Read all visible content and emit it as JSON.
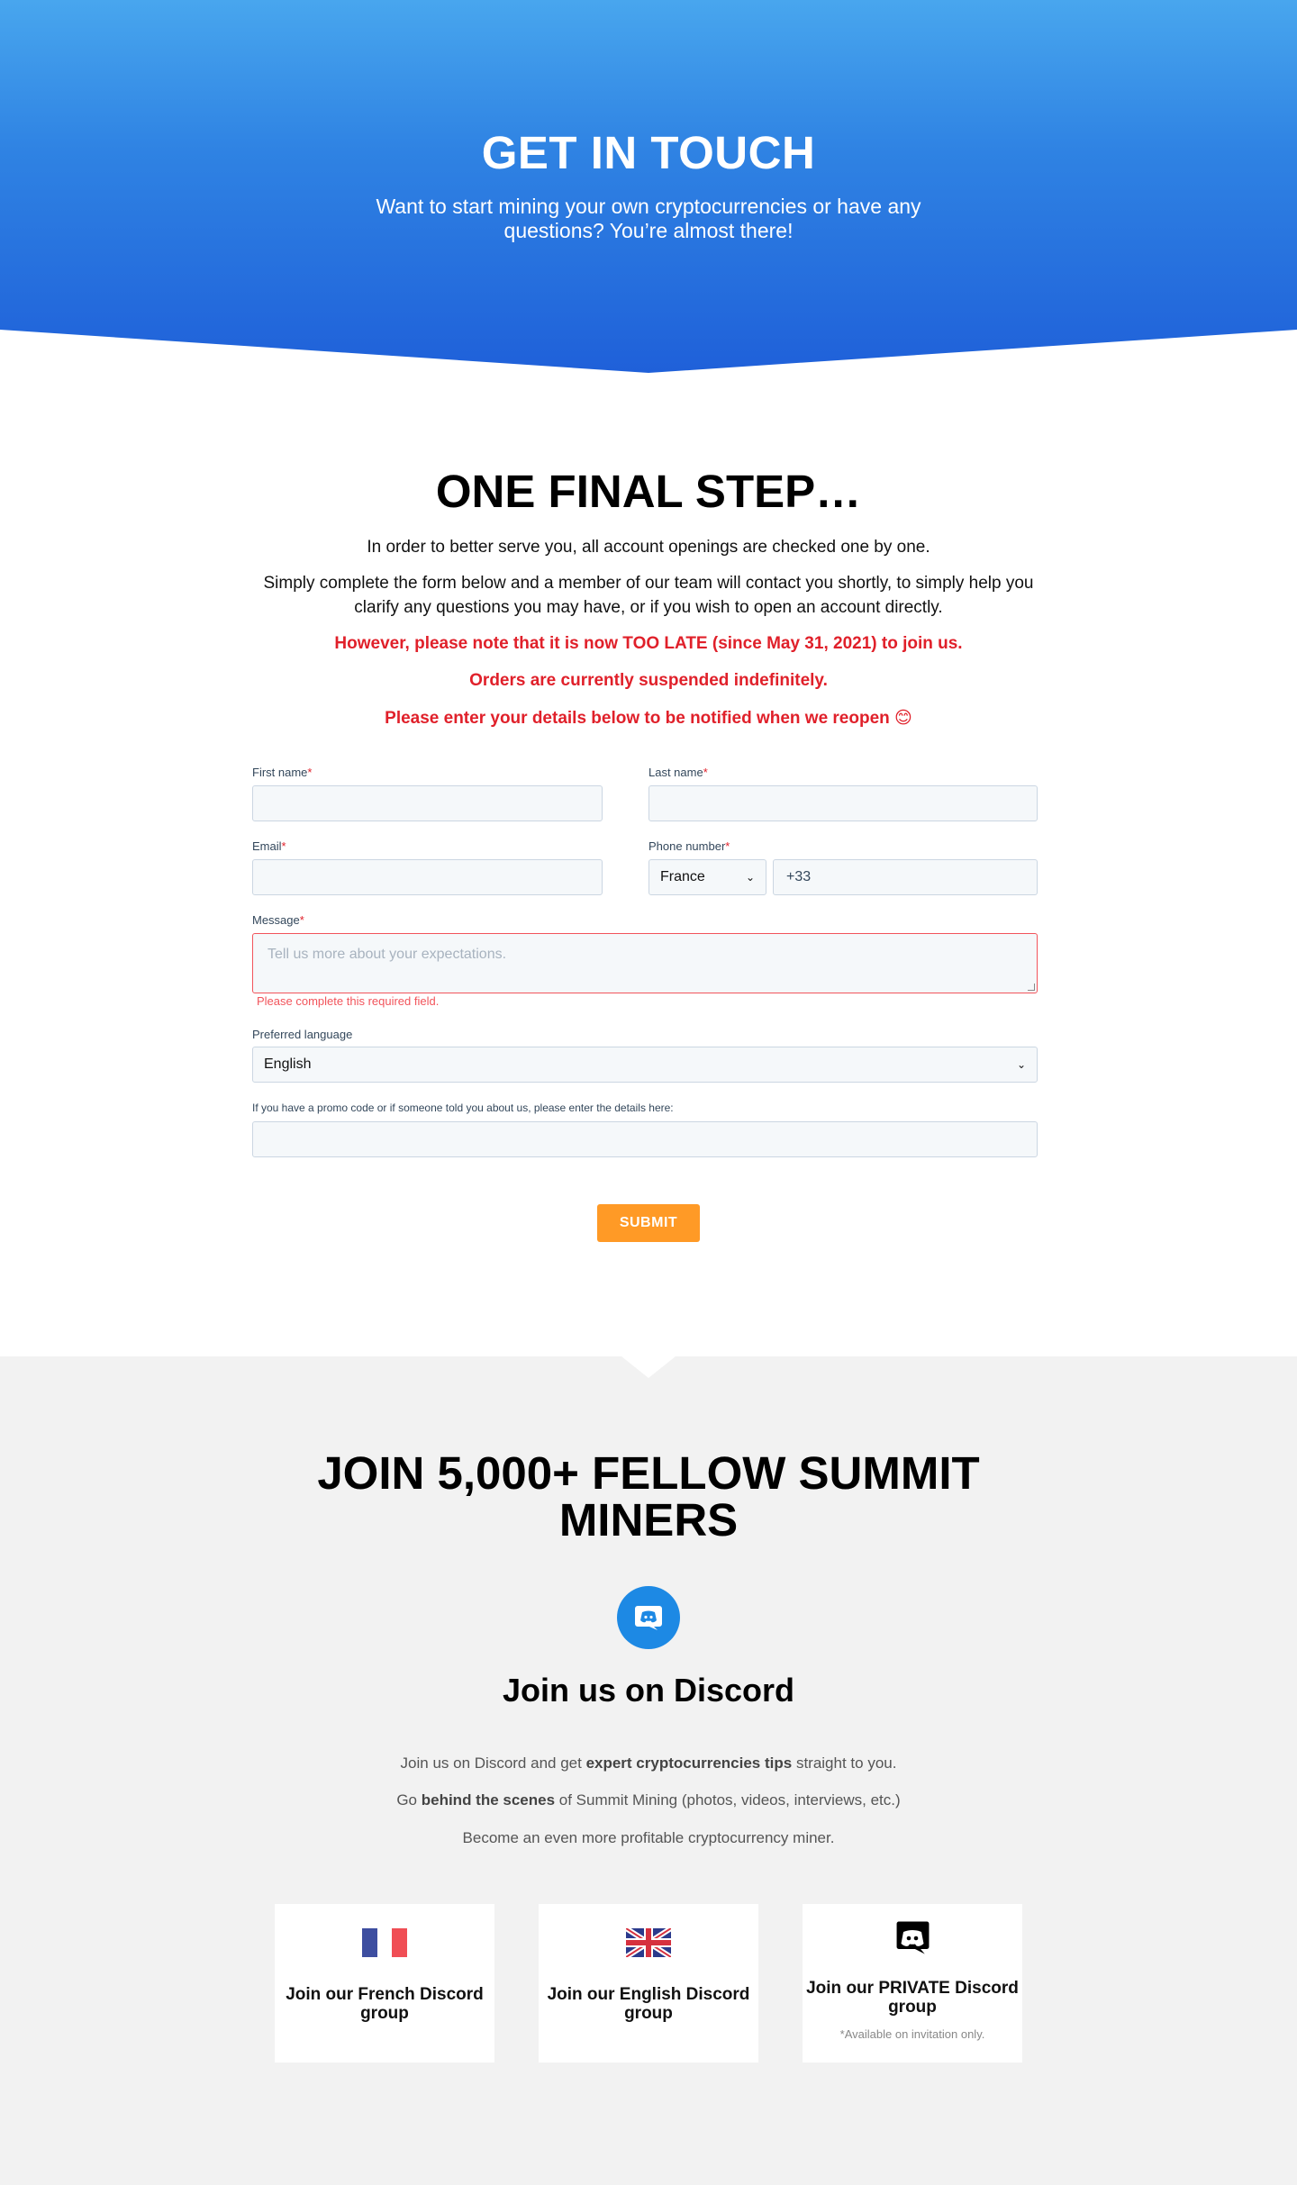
{
  "hero": {
    "title": "GET IN TOUCH",
    "subtitle": "Want to start mining your own cryptocurrencies or have any questions? You’re almost there!"
  },
  "form_section": {
    "title": "ONE FINAL STEP…",
    "intro1": "In order to better serve you, all account openings are checked one by one.",
    "intro2": "Simply complete the form below and a member of our team will contact you shortly, to simply help you clarify any questions you may have, or if you wish to open an account directly.",
    "notice1": "However, please note that it is now TOO LATE (since May 31, 2021) to join us.",
    "notice2": "Orders are currently suspended indefinitely.",
    "notice3": "Please enter your details below to be notified when we reopen 😊",
    "accent_color": "#e0202a"
  },
  "form": {
    "first_name_label": "First name",
    "last_name_label": "Last name",
    "email_label": "Email",
    "phone_label": "Phone number",
    "required_mark": "*",
    "phone_country": "France",
    "phone_prefix": "+33",
    "message_label": "Message",
    "message_placeholder": "Tell us more about your expectations.",
    "message_error": "Please complete this required field.",
    "language_label": "Preferred language",
    "language_value": "English",
    "promo_label": "If you have a promo code or if someone told you about us, please enter the details here:",
    "submit_label": "SUBMIT",
    "submit_color": "#ff9a26"
  },
  "community": {
    "title": "JOIN 5,000+ FELLOW SUMMIT MINERS",
    "discord_icon": "discord-icon",
    "discord_title": "Join us on Discord",
    "desc1_pre": "Join us on Discord and get ",
    "desc1_bold": "expert cryptocurrencies tips",
    "desc1_post": " straight to you.",
    "desc2_pre": "Go ",
    "desc2_bold": "behind the scenes",
    "desc2_post": " of Summit Mining (photos, videos, interviews, etc.)",
    "desc3": "Become an even more profitable cryptocurrency miner.",
    "cards": [
      {
        "icon": "france-flag-icon",
        "title": "Join our French Discord group",
        "note": ""
      },
      {
        "icon": "uk-flag-icon",
        "title": "Join our English Discord group",
        "note": ""
      },
      {
        "icon": "discord-icon",
        "title": "Join our PRIVATE Discord group",
        "note": "*Available on invitation only."
      }
    ],
    "discord_blue": "#1d89e4"
  }
}
